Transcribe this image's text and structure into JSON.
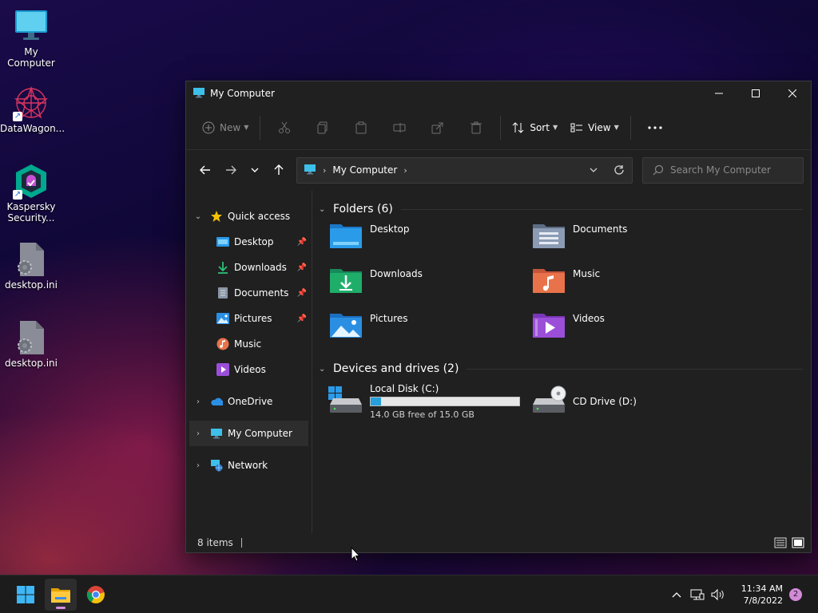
{
  "desktop": {
    "icons": [
      {
        "label": "My Computer"
      },
      {
        "label": "DataWagon..."
      },
      {
        "label": "Kaspersky Security..."
      },
      {
        "label": "desktop.ini"
      },
      {
        "label": "desktop.ini"
      }
    ]
  },
  "window": {
    "title": "My Computer",
    "toolbar": {
      "new_label": "New",
      "sort_label": "Sort",
      "view_label": "View",
      "icons": [
        "cut-icon",
        "copy-icon",
        "paste-icon",
        "rename-icon",
        "share-icon",
        "delete-icon",
        "more-icon"
      ]
    },
    "address": {
      "crumb": "My Computer"
    },
    "search": {
      "placeholder": "Search My Computer"
    },
    "sidebar": {
      "quick_access": "Quick access",
      "items": [
        {
          "label": "Desktop",
          "pinned": true
        },
        {
          "label": "Downloads",
          "pinned": true
        },
        {
          "label": "Documents",
          "pinned": true
        },
        {
          "label": "Pictures",
          "pinned": true
        },
        {
          "label": "Music",
          "pinned": false
        },
        {
          "label": "Videos",
          "pinned": false
        }
      ],
      "onedrive": "OneDrive",
      "my_computer": "My Computer",
      "network": "Network"
    },
    "folders": {
      "header": "Folders (6)",
      "items": [
        {
          "name": "Desktop",
          "color": "#1f8fe0"
        },
        {
          "name": "Documents",
          "color": "#7d8ea8"
        },
        {
          "name": "Downloads",
          "color": "#1fae6a"
        },
        {
          "name": "Music",
          "color": "#e8734a"
        },
        {
          "name": "Pictures",
          "color": "#2a8fe3"
        },
        {
          "name": "Videos",
          "color": "#9b4fd9"
        }
      ]
    },
    "drives": {
      "header": "Devices and drives (2)",
      "local_disk": {
        "name": "Local Disk (C:)",
        "used_fraction": 0.07,
        "free_text": "14.0 GB free of 15.0 GB"
      },
      "cd_drive": {
        "name": "CD Drive (D:)"
      }
    },
    "status": {
      "items": "8 items"
    }
  },
  "taskbar": {
    "time": "11:34 AM",
    "date": "7/8/2022",
    "notifications": "2"
  }
}
